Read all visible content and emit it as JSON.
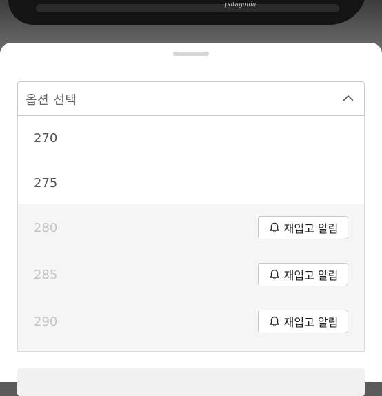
{
  "product_image": {
    "brand_text": "patagonia"
  },
  "option_select": {
    "label": "옵션 선택",
    "options": [
      {
        "size": "270",
        "status": "available"
      },
      {
        "size": "275",
        "status": "available"
      },
      {
        "size": "280",
        "status": "sold_out",
        "action_label": "재입고 알림"
      },
      {
        "size": "285",
        "status": "sold_out",
        "action_label": "재입고 알림"
      },
      {
        "size": "290",
        "status": "sold_out",
        "action_label": "재입고 알림"
      }
    ]
  },
  "icons": {
    "chevron": "chevron-up-icon",
    "restock": "bell-icon"
  }
}
